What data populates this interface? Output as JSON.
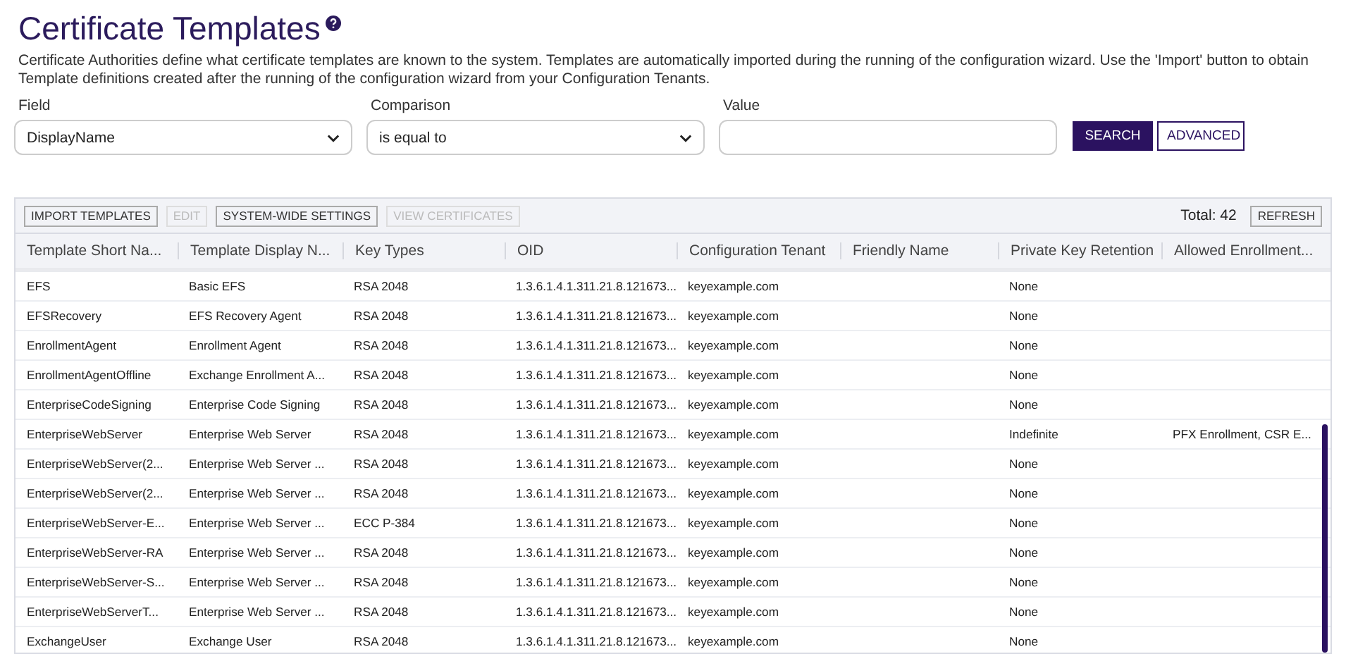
{
  "page": {
    "title": "Certificate Templates",
    "description": "Certificate Authorities define what certificate templates are known to the system. Templates are automatically imported during the running of the configuration wizard. Use the 'Import' button to obtain Template definitions created after the running of the configuration wizard from your Configuration Tenants."
  },
  "filters": {
    "field": {
      "label": "Field",
      "value": "DisplayName"
    },
    "comparison": {
      "label": "Comparison",
      "value": "is equal to"
    },
    "value": {
      "label": "Value"
    },
    "buttons": [
      {
        "label": "SEARCH",
        "kind": "primary"
      },
      {
        "label": "ADVANCED",
        "kind": "outline"
      }
    ]
  },
  "toolbar": {
    "buttons": [
      {
        "label": "IMPORT TEMPLATES",
        "disabled": false
      },
      {
        "label": "EDIT",
        "disabled": true
      },
      {
        "label": "SYSTEM-WIDE SETTINGS",
        "disabled": false
      },
      {
        "label": "VIEW CERTIFICATES",
        "disabled": true
      }
    ],
    "total": "Total: 42",
    "refresh": "REFRESH"
  },
  "table": {
    "columns": [
      "Template Short Na...",
      "Template Display N...",
      "Key Types",
      "OID",
      "Configuration Tenant",
      "Friendly Name",
      "Private Key Retention",
      "Allowed Enrollment..."
    ],
    "rows": [
      [
        "EFS",
        "Basic EFS",
        "RSA 2048",
        "1.3.6.1.4.1.311.21.8.121673...",
        "keyexample.com",
        "",
        "None",
        ""
      ],
      [
        "EFSRecovery",
        "EFS Recovery Agent",
        "RSA 2048",
        "1.3.6.1.4.1.311.21.8.121673...",
        "keyexample.com",
        "",
        "None",
        ""
      ],
      [
        "EnrollmentAgent",
        "Enrollment Agent",
        "RSA 2048",
        "1.3.6.1.4.1.311.21.8.121673...",
        "keyexample.com",
        "",
        "None",
        ""
      ],
      [
        "EnrollmentAgentOffline",
        "Exchange Enrollment A...",
        "RSA 2048",
        "1.3.6.1.4.1.311.21.8.121673...",
        "keyexample.com",
        "",
        "None",
        ""
      ],
      [
        "EnterpriseCodeSigning",
        "Enterprise Code Signing",
        "RSA 2048",
        "1.3.6.1.4.1.311.21.8.121673...",
        "keyexample.com",
        "",
        "None",
        ""
      ],
      [
        "EnterpriseWebServer",
        "Enterprise Web Server",
        "RSA 2048",
        "1.3.6.1.4.1.311.21.8.121673...",
        "keyexample.com",
        "",
        "Indefinite",
        "PFX Enrollment, CSR E..."
      ],
      [
        "EnterpriseWebServer(2...",
        "Enterprise Web Server ...",
        "RSA 2048",
        "1.3.6.1.4.1.311.21.8.121673...",
        "keyexample.com",
        "",
        "None",
        ""
      ],
      [
        "EnterpriseWebServer(2...",
        "Enterprise Web Server ...",
        "RSA 2048",
        "1.3.6.1.4.1.311.21.8.121673...",
        "keyexample.com",
        "",
        "None",
        ""
      ],
      [
        "EnterpriseWebServer-E...",
        "Enterprise Web Server ...",
        "ECC P-384",
        "1.3.6.1.4.1.311.21.8.121673...",
        "keyexample.com",
        "",
        "None",
        ""
      ],
      [
        "EnterpriseWebServer-RA",
        "Enterprise Web Server ...",
        "RSA 2048",
        "1.3.6.1.4.1.311.21.8.121673...",
        "keyexample.com",
        "",
        "None",
        ""
      ],
      [
        "EnterpriseWebServer-S...",
        "Enterprise Web Server ...",
        "RSA 2048",
        "1.3.6.1.4.1.311.21.8.121673...",
        "keyexample.com",
        "",
        "None",
        ""
      ],
      [
        "EnterpriseWebServerT...",
        "Enterprise Web Server ...",
        "RSA 2048",
        "1.3.6.1.4.1.311.21.8.121673...",
        "keyexample.com",
        "",
        "None",
        ""
      ],
      [
        "ExchangeUser",
        "Exchange User",
        "RSA 2048",
        "1.3.6.1.4.1.311.21.8.121673...",
        "keyexample.com",
        "",
        "None",
        ""
      ]
    ]
  }
}
